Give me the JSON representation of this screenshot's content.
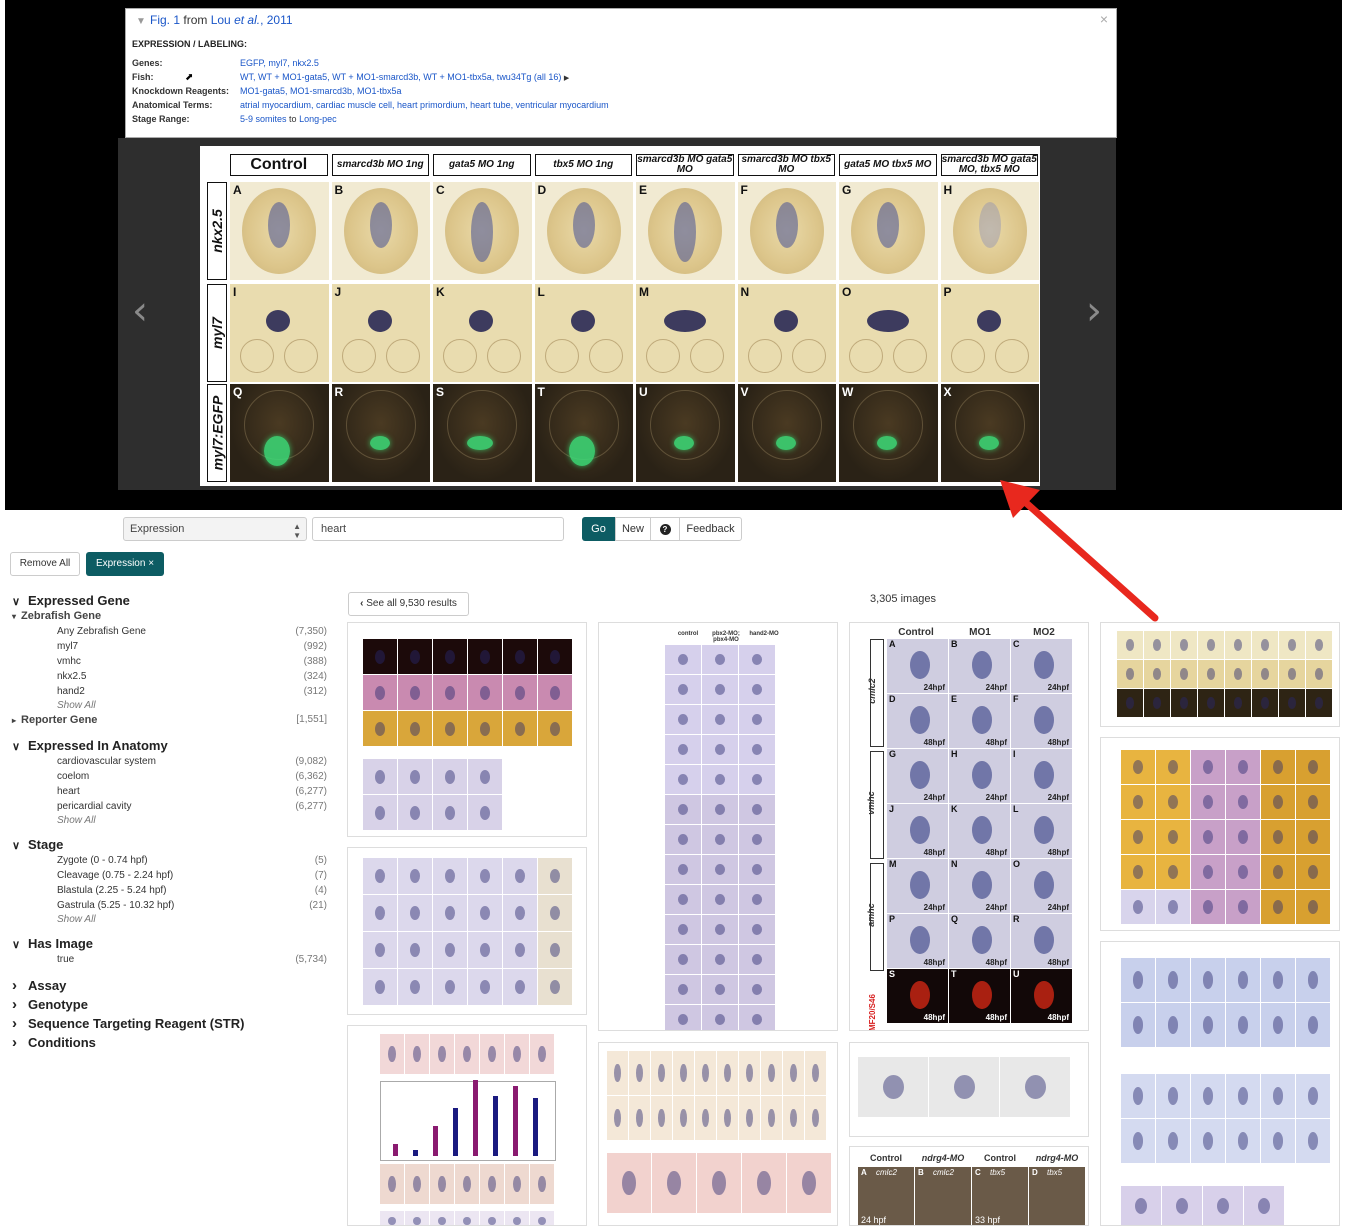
{
  "viewer": {
    "header_toggle": "Fig. 1",
    "header_from": "from",
    "header_author": "Lou",
    "header_etal": "et al.",
    "header_year": ", 2011",
    "section": "EXPRESSION / LABELING:",
    "genes_label": "Genes:",
    "genes_value": "EGFP, myl7, nkx2.5",
    "fish_label": "Fish:",
    "fish_value": "WT, WT + MO1-gata5, WT + MO1-smarcd3b, WT + MO1-tbx5a, twu34Tg (all 16)",
    "knockdown_label": "Knockdown Reagents:",
    "knockdown_value": "MO1-gata5, MO1-smarcd3b, MO1-tbx5a",
    "anatomy_label": "Anatomical Terms:",
    "anatomy_value": "atrial myocardium, cardiac muscle cell, heart primordium, heart tube, ventricular myocardium",
    "stage_label": "Stage Range:",
    "stage_from": "5-9 somites",
    "stage_to_word": "to",
    "stage_to": "Long-pec",
    "close": "×",
    "prev": "‹",
    "next": "›"
  },
  "figure": {
    "columns": [
      "Control",
      "smarcd3b MO 1ng",
      "gata5 MO 1ng",
      "tbx5 MO 1ng",
      "smarcd3b MO gata5 MO",
      "smarcd3b MO tbx5 MO",
      "gata5 MO tbx5 MO",
      "smarcd3b MO gata5 MO, tbx5 MO"
    ],
    "rows": [
      "nkx2.5",
      "myl7",
      "myl7:EGFP"
    ],
    "letters": [
      [
        "A",
        "B",
        "C",
        "D",
        "E",
        "F",
        "G",
        "H"
      ],
      [
        "I",
        "J",
        "K",
        "L",
        "M",
        "N",
        "O",
        "P"
      ],
      [
        "Q",
        "R",
        "S",
        "T",
        "U",
        "V",
        "W",
        "X"
      ]
    ]
  },
  "search": {
    "category": "Expression",
    "query": "heart",
    "go": "Go",
    "new": "New",
    "help": "?",
    "feedback": "Feedback",
    "remove_all": "Remove All",
    "active_filter": "Expression ×"
  },
  "facets": {
    "expressed_gene": {
      "title": "Expressed Gene",
      "sub": "Zebrafish Gene",
      "items": [
        {
          "name": "Any Zebrafish Gene",
          "count": "(7,350)"
        },
        {
          "name": "myl7",
          "count": "(992)"
        },
        {
          "name": "vmhc",
          "count": "(388)"
        },
        {
          "name": "nkx2.5",
          "count": "(324)"
        },
        {
          "name": "hand2",
          "count": "(312)"
        }
      ],
      "show_all": "Show All",
      "reporter": "Reporter Gene",
      "reporter_count": "[1,551]"
    },
    "anatomy": {
      "title": "Expressed In Anatomy",
      "items": [
        {
          "name": "cardiovascular system",
          "count": "(9,082)"
        },
        {
          "name": "coelom",
          "count": "(6,362)"
        },
        {
          "name": "heart",
          "count": "(6,277)"
        },
        {
          "name": "pericardial cavity",
          "count": "(6,277)"
        }
      ],
      "show_all": "Show All"
    },
    "stage": {
      "title": "Stage",
      "items": [
        {
          "name": "Zygote (0 - 0.74 hpf)",
          "count": "(5)"
        },
        {
          "name": "Cleavage (0.75 - 2.24 hpf)",
          "count": "(7)"
        },
        {
          "name": "Blastula (2.25 - 5.24 hpf)",
          "count": "(4)"
        },
        {
          "name": "Gastrula (5.25 - 10.32 hpf)",
          "count": "(21)"
        }
      ],
      "show_all": "Show All"
    },
    "has_image": {
      "title": "Has Image",
      "items": [
        {
          "name": "true",
          "count": "(5,734)"
        }
      ]
    },
    "collapsed": [
      "Assay",
      "Genotype",
      "Sequence Targeting Reagent (STR)",
      "Conditions"
    ]
  },
  "results": {
    "see_all": "See all 9,530 results",
    "image_count": "3,305 images",
    "card3_cols": [
      "Control",
      "MO1",
      "MO2"
    ],
    "card3_rows": [
      "cmlc2",
      "vmhc",
      "amhc"
    ],
    "card3_letters": [
      "A",
      "B",
      "C",
      "D",
      "E",
      "F",
      "G",
      "H",
      "I",
      "J",
      "K",
      "L",
      "M",
      "N",
      "O",
      "P",
      "Q",
      "R",
      "S",
      "T",
      "U"
    ],
    "card3_stage": [
      "24hpf",
      "48hpf"
    ],
    "card3_bottom": "MF20/S46",
    "card_bottom_cols": [
      "Control",
      "ndrg4-MO",
      "Control",
      "ndrg4-MO"
    ],
    "card_bottom_labels": [
      "A",
      "cmlc2",
      "B",
      "cmlc2",
      "C",
      "tbx5",
      "D",
      "tbx5"
    ],
    "card_bottom_stage": [
      "24 hpf",
      "33 hpf"
    ],
    "card2_cols": [
      "control",
      "pbx2-MO; pbx4-MO",
      "hand2-MO"
    ]
  },
  "colors": {
    "brand": "#0d5c63",
    "link": "#1a56c8",
    "annotation_arrow": "#e8281e"
  }
}
